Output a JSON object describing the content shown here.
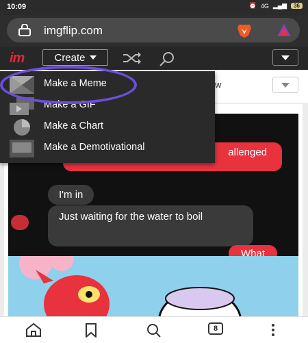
{
  "status_bar": {
    "time": "10:09",
    "network": "4G",
    "battery": "36"
  },
  "browser": {
    "url": "imgflip.com",
    "brave_icon": "brave-lion-icon",
    "rewards_icon": "triangle-icon"
  },
  "toolbar": {
    "logo": "im",
    "create_label": "Create"
  },
  "subbar": {
    "text": "w"
  },
  "create_menu": [
    {
      "label": "Make a Meme",
      "icon": "meme-template-icon"
    },
    {
      "label": "Make a GIF",
      "icon": "gif-frames-icon"
    },
    {
      "label": "Make a Chart",
      "icon": "pie-chart-icon"
    },
    {
      "label": "Make a Demotivational",
      "icon": "demotivational-frame-icon"
    }
  ],
  "meme": {
    "bubbles": [
      {
        "text": "allenged",
        "style": "red"
      },
      {
        "text": "I'm in",
        "style": "gray"
      },
      {
        "text": "Just waiting for the water to boil",
        "style": "gray"
      },
      {
        "text": "What",
        "style": "red"
      }
    ]
  },
  "bottom_nav": {
    "tab_count": "8"
  },
  "colors": {
    "accent": "#e8233c",
    "highlight_circle": "#6c4ed8",
    "menu_bg": "#2a2a2a"
  }
}
